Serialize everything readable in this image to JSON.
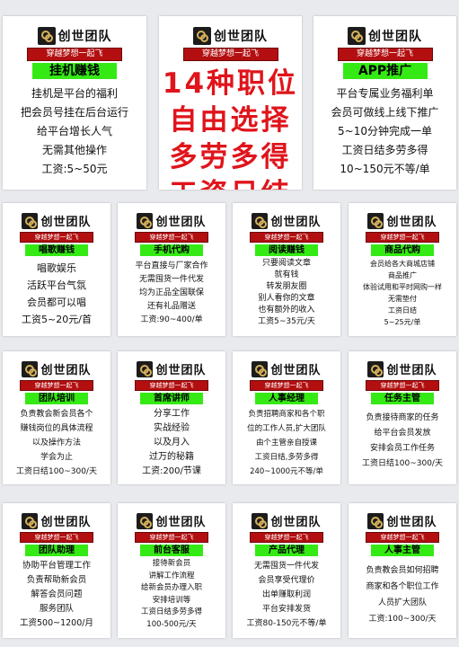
{
  "brand": "创世团队",
  "slogan": "穿越梦想一起飞",
  "center_lines": [
    "14种职位",
    "自由选择",
    "多劳多得",
    "工资日结"
  ],
  "cards": {
    "c1": {
      "title": "挂机赚钱",
      "lines": [
        "挂机是平台的福利",
        "把会员号挂在后台运行",
        "给平台增长人气",
        "无需其他操作",
        "工资:5~50元"
      ]
    },
    "c3": {
      "title": "APP推广",
      "lines": [
        "平台专属业务福利单",
        "会员可做线上线下推广",
        "5~10分钟完成一单",
        "工资日结多劳多得",
        "10~150元不等/单"
      ]
    },
    "c4": {
      "title": "唱歌赚钱",
      "lines": [
        "唱歌娱乐",
        "活跃平台气氛",
        "会员都可以唱",
        "工资5~20元/首"
      ]
    },
    "c5": {
      "title": "手机代购",
      "lines": [
        "平台直接与厂家合作",
        "无需囤货一件代发",
        "均为正品全国联保",
        "还有礼品赠送",
        "工资:90~400/单"
      ]
    },
    "c6": {
      "title": "阅读赚钱",
      "lines": [
        "只要阅读文章",
        "就有钱",
        "转发朋友圈",
        "别人看你的文章",
        "也有额外的收入",
        "工资5~35元/天"
      ]
    },
    "c7": {
      "title": "商品代购",
      "lines": [
        "会员给各大商城店铺",
        "商品推广",
        "体验试用和平时网购一样",
        "无需垫付",
        "工资日结",
        "5~25元/单"
      ]
    },
    "c8": {
      "title": "团队培训",
      "lines": [
        "负责教会新会员各个",
        "赚钱岗位的具体流程",
        "以及操作方法",
        "学会为止",
        "工资日结100~300/天"
      ]
    },
    "c9": {
      "title": "首席讲师",
      "lines": [
        "分享工作",
        "实战经验",
        "以及月入",
        "过万的秘籍",
        "工资:200/节课"
      ]
    },
    "c10": {
      "title": "人事经理",
      "lines": [
        "负责招聘商家和各个职",
        "位的工作人员,扩大团队",
        "由个主管亲自授课",
        "工资日结,多劳多得",
        "240~1000元不等/单"
      ]
    },
    "c11": {
      "title": "任务主管",
      "lines": [
        "负责接待商家的任务",
        "给平台会员发放",
        "安排会员工作任务",
        "工资日结100~300/天"
      ]
    },
    "c12": {
      "title": "团队助理",
      "lines": [
        "协助平台管理工作",
        "负责帮助新会员",
        "解答会员问题",
        "服务团队",
        "工资500~1200/月"
      ]
    },
    "c13": {
      "title": "前台客服",
      "lines": [
        "接待新会员",
        "讲解工作流程",
        "给新会员办理入职",
        "安排培训等",
        "工资日结多劳多得",
        "100-500元/天"
      ]
    },
    "c14": {
      "title": "产品代理",
      "lines": [
        "无需囤货一件代发",
        "会员享受代理价",
        "出单赚取利润",
        "平台安排发货",
        "工资80-150元不等/单"
      ]
    },
    "c15": {
      "title": "人事主管",
      "lines": [
        "负责教会员如何招聘",
        "商家和各个职位工作",
        "人员扩大团队",
        "工资:100~300/天"
      ]
    }
  }
}
